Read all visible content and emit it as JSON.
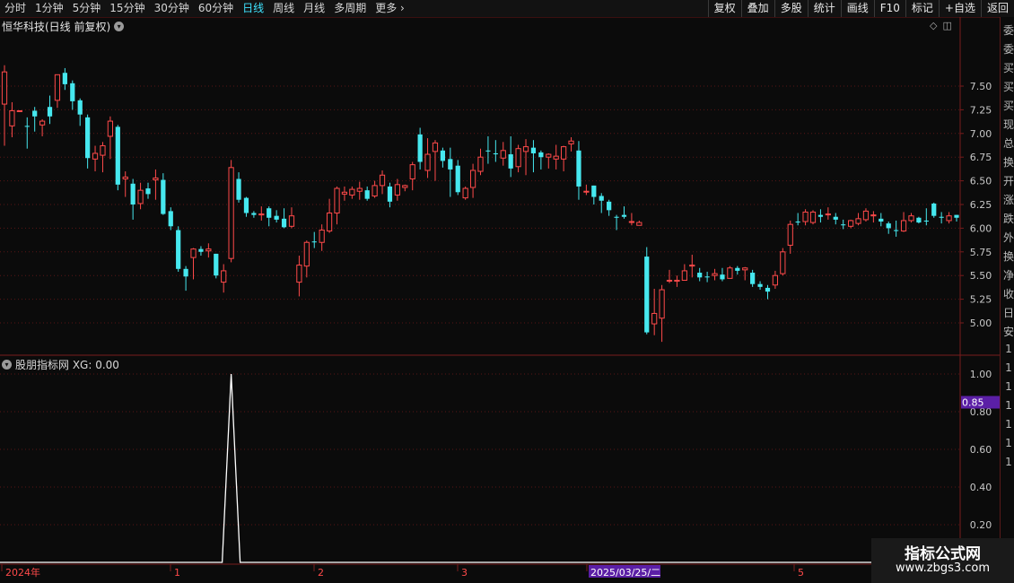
{
  "toolbar": {
    "periods": [
      "分时",
      "1分钟",
      "5分钟",
      "15分钟",
      "30分钟",
      "60分钟",
      "日线",
      "周线",
      "月线",
      "多周期",
      "更多"
    ],
    "active_period": "日线",
    "more_chevron": "›",
    "right_buttons": [
      "复权",
      "叠加",
      "多股",
      "统计",
      "画线",
      "F10",
      "标记",
      "+自选",
      "返回"
    ]
  },
  "main_chart": {
    "title": "恒华科技(日线 前复权)",
    "y_ticks": [
      "7.50",
      "7.25",
      "7.00",
      "6.75",
      "6.50",
      "6.25",
      "6.00",
      "5.75",
      "5.50",
      "5.25",
      "5.00"
    ],
    "icons": [
      "diamond-icon",
      "window-restore-icon"
    ]
  },
  "indicator": {
    "label": "股朋指标网 XG: 0.00",
    "y_ticks": [
      "1.00",
      "0.80",
      "0.60",
      "0.40",
      "0.20"
    ],
    "highlight_value": "0.85"
  },
  "x_axis": {
    "labels": [
      "2024年",
      "1",
      "2",
      "3",
      "2025/03/25/二",
      "5"
    ]
  },
  "right_strip_chars": [
    "委",
    "委",
    "买",
    "买",
    "买",
    "现",
    "总",
    "换",
    "开",
    "涨",
    "跌",
    "外",
    "换",
    "净",
    "收",
    "日",
    "安",
    "1",
    "1",
    "1",
    "1",
    "1",
    "1",
    "1"
  ],
  "watermark": {
    "name": "指标公式网",
    "url": "www.zbgs3.com"
  },
  "colors": {
    "up": "#ff4a4a",
    "down": "#46e8ef",
    "grid": "#5a1616",
    "highlight_bg": "#5b1fa6"
  },
  "candles": [
    [
      7.31,
      7.65,
      7.72,
      6.87
    ],
    [
      7.08,
      7.24,
      7.33,
      6.96
    ],
    [
      7.24,
      7.24,
      7.24,
      7.24
    ],
    [
      7.08,
      7.07,
      7.17,
      6.84
    ],
    [
      7.24,
      7.18,
      7.28,
      7.02
    ],
    [
      7.09,
      7.13,
      7.15,
      6.97
    ],
    [
      7.28,
      7.18,
      7.4,
      7.1
    ],
    [
      7.35,
      7.62,
      7.59,
      7.27
    ],
    [
      7.64,
      7.52,
      7.69,
      7.46
    ],
    [
      7.53,
      7.34,
      7.56,
      7.25
    ],
    [
      7.35,
      7.2,
      7.37,
      7.08
    ],
    [
      7.17,
      6.74,
      7.2,
      6.63
    ],
    [
      6.73,
      6.79,
      6.87,
      6.6
    ],
    [
      6.77,
      6.87,
      6.91,
      6.59
    ],
    [
      6.97,
      7.13,
      7.18,
      6.73
    ],
    [
      7.07,
      6.46,
      7.09,
      6.4
    ],
    [
      6.52,
      6.54,
      6.6,
      6.33
    ],
    [
      6.47,
      6.25,
      6.52,
      6.09
    ],
    [
      6.26,
      6.4,
      6.48,
      6.2
    ],
    [
      6.42,
      6.36,
      6.48,
      6.31
    ],
    [
      6.51,
      6.53,
      6.62,
      6.3
    ],
    [
      6.51,
      6.15,
      6.58,
      6.14
    ],
    [
      6.18,
      6.02,
      6.22,
      5.98
    ],
    [
      5.98,
      5.57,
      6.02,
      5.54
    ],
    [
      5.57,
      5.49,
      5.6,
      5.34
    ],
    [
      5.69,
      5.78,
      5.79,
      5.46
    ],
    [
      5.78,
      5.75,
      5.81,
      5.71
    ],
    [
      5.76,
      5.78,
      5.84,
      5.69
    ],
    [
      5.73,
      5.5,
      5.73,
      5.47
    ],
    [
      5.43,
      5.55,
      5.62,
      5.32
    ],
    [
      5.68,
      6.64,
      6.72,
      5.64
    ],
    [
      6.52,
      6.3,
      6.59,
      6.27
    ],
    [
      6.32,
      6.16,
      6.33,
      6.12
    ],
    [
      6.16,
      6.14,
      6.18,
      6.11
    ],
    [
      6.14,
      6.15,
      6.23,
      6.08
    ],
    [
      6.21,
      6.11,
      6.23,
      6.02
    ],
    [
      6.13,
      6.09,
      6.19,
      6.06
    ],
    [
      6.1,
      6.01,
      6.21,
      6.0
    ],
    [
      6.02,
      6.13,
      6.22,
      6.0
    ],
    [
      5.43,
      5.61,
      5.71,
      5.28
    ],
    [
      5.6,
      5.85,
      5.87,
      5.48
    ],
    [
      5.86,
      5.85,
      5.96,
      5.79
    ],
    [
      5.85,
      5.98,
      6.04,
      5.76
    ],
    [
      5.97,
      6.16,
      6.31,
      5.95
    ],
    [
      6.16,
      6.42,
      6.44,
      6.04
    ],
    [
      6.36,
      6.38,
      6.44,
      6.29
    ],
    [
      6.35,
      6.41,
      6.44,
      6.31
    ],
    [
      6.39,
      6.42,
      6.49,
      6.3
    ],
    [
      6.4,
      6.31,
      6.44,
      6.29
    ],
    [
      6.34,
      6.45,
      6.5,
      6.32
    ],
    [
      6.45,
      6.56,
      6.61,
      6.36
    ],
    [
      6.44,
      6.28,
      6.48,
      6.22
    ],
    [
      6.35,
      6.46,
      6.52,
      6.29
    ],
    [
      6.43,
      6.45,
      6.46,
      6.39
    ],
    [
      6.52,
      6.67,
      6.7,
      6.4
    ],
    [
      6.99,
      6.7,
      7.06,
      6.62
    ],
    [
      6.61,
      6.78,
      6.95,
      6.53
    ],
    [
      6.81,
      6.9,
      6.93,
      6.5
    ],
    [
      6.82,
      6.71,
      6.85,
      6.64
    ],
    [
      6.73,
      6.62,
      6.85,
      6.33
    ],
    [
      6.66,
      6.38,
      6.72,
      6.35
    ],
    [
      6.32,
      6.42,
      6.44,
      6.3
    ],
    [
      6.43,
      6.61,
      6.68,
      6.32
    ],
    [
      6.6,
      6.75,
      6.84,
      6.56
    ],
    [
      6.82,
      6.81,
      6.97,
      6.68
    ],
    [
      6.79,
      6.78,
      6.93,
      6.7
    ],
    [
      6.74,
      6.82,
      6.91,
      6.66
    ],
    [
      6.78,
      6.63,
      6.97,
      6.54
    ],
    [
      6.65,
      6.84,
      6.88,
      6.59
    ],
    [
      6.81,
      6.86,
      6.94,
      6.56
    ],
    [
      6.85,
      6.79,
      6.93,
      6.59
    ],
    [
      6.8,
      6.75,
      6.82,
      6.62
    ],
    [
      6.75,
      6.78,
      6.79,
      6.63
    ],
    [
      6.73,
      6.76,
      6.88,
      6.62
    ],
    [
      6.73,
      6.86,
      6.87,
      6.6
    ],
    [
      6.89,
      6.92,
      6.96,
      6.81
    ],
    [
      6.82,
      6.44,
      6.92,
      6.3
    ],
    [
      6.39,
      6.39,
      6.46,
      6.35
    ],
    [
      6.45,
      6.33,
      6.45,
      6.25
    ],
    [
      6.34,
      6.29,
      6.37,
      6.16
    ],
    [
      6.28,
      6.19,
      6.3,
      6.13
    ],
    [
      6.12,
      6.11,
      6.14,
      5.98
    ],
    [
      6.14,
      6.12,
      6.23,
      6.1
    ],
    [
      6.07,
      6.07,
      6.16,
      6.03
    ],
    [
      6.03,
      6.06,
      6.08,
      6.03
    ],
    [
      5.7,
      4.9,
      5.8,
      4.88
    ],
    [
      4.99,
      5.1,
      5.36,
      4.87
    ],
    [
      5.05,
      5.35,
      5.4,
      4.8
    ],
    [
      5.45,
      5.45,
      5.56,
      5.42
    ],
    [
      5.44,
      5.45,
      5.5,
      5.38
    ],
    [
      5.45,
      5.55,
      5.62,
      5.46
    ],
    [
      5.6,
      5.61,
      5.72,
      5.48
    ],
    [
      5.53,
      5.48,
      5.58,
      5.44
    ],
    [
      5.49,
      5.48,
      5.54,
      5.43
    ],
    [
      5.5,
      5.52,
      5.57,
      5.45
    ],
    [
      5.51,
      5.46,
      5.58,
      5.44
    ],
    [
      5.47,
      5.58,
      5.6,
      5.47
    ],
    [
      5.58,
      5.55,
      5.6,
      5.51
    ],
    [
      5.56,
      5.58,
      5.59,
      5.45
    ],
    [
      5.53,
      5.41,
      5.56,
      5.38
    ],
    [
      5.41,
      5.38,
      5.44,
      5.35
    ],
    [
      5.37,
      5.33,
      5.4,
      5.25
    ],
    [
      5.4,
      5.5,
      5.55,
      5.36
    ],
    [
      5.52,
      5.75,
      5.79,
      5.5
    ],
    [
      5.82,
      6.04,
      6.08,
      5.73
    ],
    [
      6.07,
      6.06,
      6.16,
      6.03
    ],
    [
      6.07,
      6.17,
      6.2,
      6.03
    ],
    [
      6.06,
      6.17,
      6.19,
      6.04
    ],
    [
      6.14,
      6.12,
      6.2,
      6.06
    ],
    [
      6.15,
      6.15,
      6.22,
      6.09
    ],
    [
      6.12,
      6.09,
      6.16,
      6.04
    ],
    [
      6.04,
      6.03,
      6.09,
      5.99
    ],
    [
      6.02,
      6.08,
      6.09,
      6.0
    ],
    [
      6.05,
      6.1,
      6.16,
      6.03
    ],
    [
      6.09,
      6.18,
      6.21,
      6.07
    ],
    [
      6.13,
      6.14,
      6.18,
      6.06
    ],
    [
      6.1,
      6.07,
      6.16,
      6.02
    ],
    [
      6.05,
      6.0,
      6.07,
      5.94
    ],
    [
      5.98,
      5.97,
      6.08,
      5.91
    ],
    [
      5.97,
      6.08,
      6.17,
      5.96
    ],
    [
      6.08,
      6.13,
      6.16,
      6.06
    ],
    [
      6.11,
      6.06,
      6.12,
      6.05
    ],
    [
      6.08,
      6.07,
      6.21,
      6.03
    ],
    [
      6.26,
      6.13,
      6.27,
      6.11
    ],
    [
      6.12,
      6.11,
      6.17,
      6.05
    ],
    [
      6.08,
      6.13,
      6.17,
      6.05
    ],
    [
      6.14,
      6.11,
      6.14,
      6.07
    ]
  ],
  "xg_signal_index": 30
}
